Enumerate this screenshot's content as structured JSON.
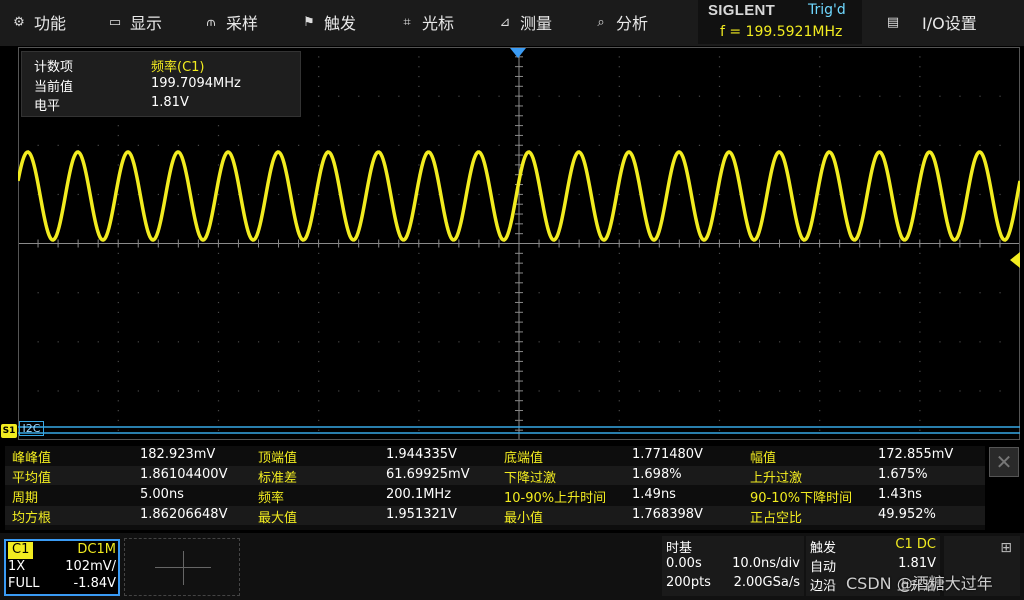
{
  "menu": [
    {
      "id": "function",
      "icon": "gear-icon",
      "glyph": "⚙",
      "label": "功能"
    },
    {
      "id": "display",
      "icon": "monitor-icon",
      "glyph": "▭",
      "label": "显示"
    },
    {
      "id": "acquire",
      "icon": "acquire-icon",
      "glyph": "⫙",
      "label": "采样"
    },
    {
      "id": "trigger",
      "icon": "flag-icon",
      "glyph": "⚑",
      "label": "触发"
    },
    {
      "id": "cursor",
      "icon": "crosshair-icon",
      "glyph": "⌗",
      "label": "光标"
    },
    {
      "id": "measure",
      "icon": "measure-icon",
      "glyph": "⊿",
      "label": "测量"
    },
    {
      "id": "analysis",
      "icon": "analysis-icon",
      "glyph": "⌕",
      "label": "分析"
    },
    {
      "id": "io",
      "icon": "io-icon",
      "glyph": "▤",
      "label": "I/O设置"
    }
  ],
  "brand": {
    "name": "SIGLENT",
    "trig_state": "Trig'd",
    "freq": "f = 199.5921MHz"
  },
  "measure_overlay": {
    "rows": [
      {
        "key": "计数项",
        "value": "频率(C1)"
      },
      {
        "key": "当前值",
        "value": "199.7094MHz"
      },
      {
        "key": "电平",
        "value": "1.81V"
      }
    ]
  },
  "markers": {
    "ch1": "S1",
    "i2c": "I2C"
  },
  "measurements": [
    [
      {
        "label": "峰峰值",
        "value": "182.923mV"
      },
      {
        "label": "顶端值",
        "value": "1.944335V"
      },
      {
        "label": "底端值",
        "value": "1.771480V"
      },
      {
        "label": "幅值",
        "value": "172.855mV"
      }
    ],
    [
      {
        "label": "平均值",
        "value": "1.86104400V"
      },
      {
        "label": "标准差",
        "value": "61.69925mV"
      },
      {
        "label": "下降过激",
        "value": "1.698%"
      },
      {
        "label": "上升过激",
        "value": "1.675%"
      }
    ],
    [
      {
        "label": "周期",
        "value": "5.00ns"
      },
      {
        "label": "频率",
        "value": "200.1MHz"
      },
      {
        "label": "10-90%上升时间",
        "value": "1.49ns"
      },
      {
        "label": "90-10%下降时间",
        "value": "1.43ns"
      }
    ],
    [
      {
        "label": "均方根",
        "value": "1.86206648V"
      },
      {
        "label": "最大值",
        "value": "1.951321V"
      },
      {
        "label": "最小值",
        "value": "1.768398V"
      },
      {
        "label": "正占空比",
        "value": "49.952%"
      }
    ]
  ],
  "ch1_panel": {
    "name": "C1",
    "coupling": "DC1M",
    "probe": "1X",
    "scale": "102mV/",
    "bw": "FULL",
    "offset": "-1.84V"
  },
  "timebase": {
    "title": "时基",
    "delay": "0.00s",
    "scale": "10.0ns/div",
    "points": "200pts",
    "rate": "2.00GSa/s"
  },
  "trigger": {
    "title": "触发",
    "source": "C1 DC",
    "mode": "自动",
    "level": "1.81V",
    "type": "边沿",
    "slope": "上升沿"
  },
  "watermark": "CSDN @酒糖大过年",
  "colors": {
    "ch1": "#f2ec20",
    "i2c": "#37a8e6",
    "grid": "#4a4a4a",
    "accent": "#3a9bf4"
  }
}
